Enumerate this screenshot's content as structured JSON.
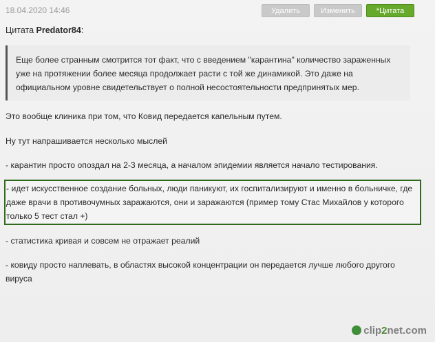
{
  "post": {
    "timestamp": "18.04.2020 14:46",
    "buttons": {
      "delete": "Удалить",
      "edit": "Изменить",
      "quote": "*Цитата"
    },
    "quote": {
      "prefix": "Цитата ",
      "author": "Predator84",
      "suffix": ":",
      "text": "Еще более странным смотрится тот факт, что с введением \"карантина\" количество зараженных уже на протяжении более месяца продолжает расти с той же динамикой. Это даже на официальном уровне свидетельствует о полной несостоятельности предпринятых мер."
    },
    "paragraphs": [
      "Это вообще клиника при том, что Ковид передается капельным путем.",
      "Ну тут напрашивается несколько мыслей",
      "-  карантин просто опоздал на 2-3 месяца, а началом эпидемии является начало тестирования.",
      "- идет искусственное создание больных, люди паникуют, их госпитализируют и именно в больничке, где даже врачи в противочумных заражаются, они и заражаются  (пример тому Стас Михайлов у которого только 5 тест стал +)",
      "-  статистика кривая и совсем не отражает реалий",
      "-  ковиду просто наплевать, в областях высокой концентрации он передается лучше любого другого вируса"
    ]
  },
  "watermark": {
    "part1": "clip",
    "part2": "2",
    "part3": "net.com"
  },
  "colors": {
    "quote_button": "#66a92b",
    "highlight_border": "#2f6a1e",
    "quote_bar": "#555555"
  }
}
